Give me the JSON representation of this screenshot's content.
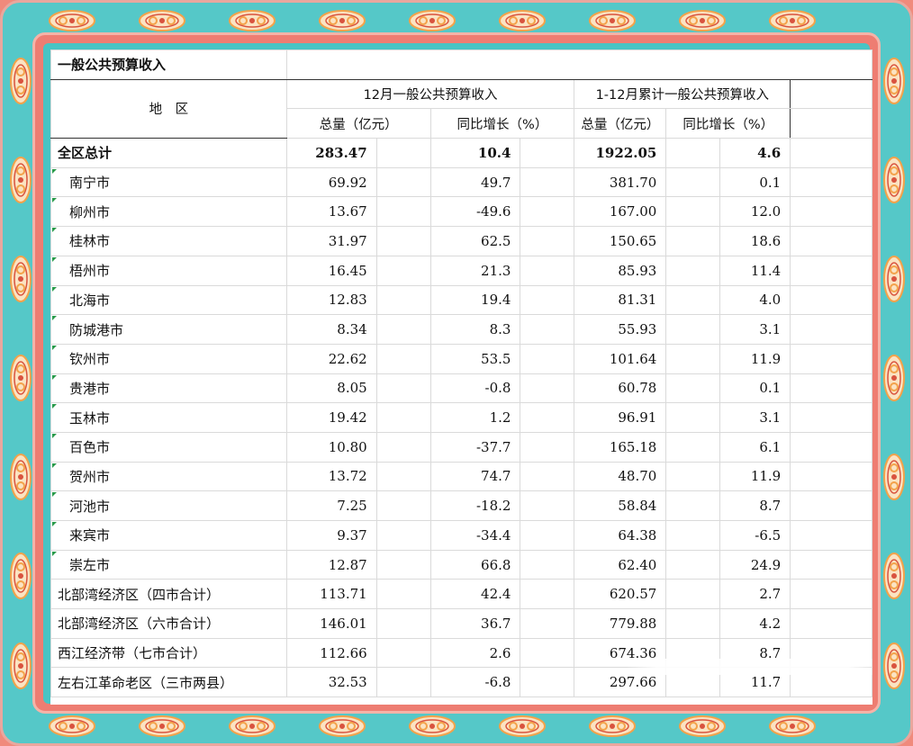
{
  "sheet": {
    "title": "一般公共预算收入",
    "region_header": "地　区",
    "group1_header": "12月一般公共预算收入",
    "group2_header": "1-12月累计一般公共预算收入",
    "sub_total": "总量（亿元）",
    "sub_growth": "同比增长（%）",
    "total_row": {
      "name": "全区总计",
      "m_total": "283.47",
      "m_growth": "10.4",
      "c_total": "1922.05",
      "c_growth": "4.6"
    },
    "rows": [
      {
        "name": "南宁市",
        "m_total": "69.92",
        "m_growth": "49.7",
        "c_total": "381.70",
        "c_growth": "0.1",
        "city": true
      },
      {
        "name": "柳州市",
        "m_total": "13.67",
        "m_growth": "-49.6",
        "c_total": "167.00",
        "c_growth": "12.0",
        "city": true
      },
      {
        "name": "桂林市",
        "m_total": "31.97",
        "m_growth": "62.5",
        "c_total": "150.65",
        "c_growth": "18.6",
        "city": true
      },
      {
        "name": "梧州市",
        "m_total": "16.45",
        "m_growth": "21.3",
        "c_total": "85.93",
        "c_growth": "11.4",
        "city": true
      },
      {
        "name": "北海市",
        "m_total": "12.83",
        "m_growth": "19.4",
        "c_total": "81.31",
        "c_growth": "4.0",
        "city": true
      },
      {
        "name": "防城港市",
        "m_total": "8.34",
        "m_growth": "8.3",
        "c_total": "55.93",
        "c_growth": "3.1",
        "city": true
      },
      {
        "name": "钦州市",
        "m_total": "22.62",
        "m_growth": "53.5",
        "c_total": "101.64",
        "c_growth": "11.9",
        "city": true
      },
      {
        "name": "贵港市",
        "m_total": "8.05",
        "m_growth": "-0.8",
        "c_total": "60.78",
        "c_growth": "0.1",
        "city": true
      },
      {
        "name": "玉林市",
        "m_total": "19.42",
        "m_growth": "1.2",
        "c_total": "96.91",
        "c_growth": "3.1",
        "city": true
      },
      {
        "name": "百色市",
        "m_total": "10.80",
        "m_growth": "-37.7",
        "c_total": "165.18",
        "c_growth": "6.1",
        "city": true
      },
      {
        "name": "贺州市",
        "m_total": "13.72",
        "m_growth": "74.7",
        "c_total": "48.70",
        "c_growth": "11.9",
        "city": true
      },
      {
        "name": "河池市",
        "m_total": "7.25",
        "m_growth": "-18.2",
        "c_total": "58.84",
        "c_growth": "8.7",
        "city": true
      },
      {
        "name": "来宾市",
        "m_total": "9.37",
        "m_growth": "-34.4",
        "c_total": "64.38",
        "c_growth": "-6.5",
        "city": true
      },
      {
        "name": "崇左市",
        "m_total": "12.87",
        "m_growth": "66.8",
        "c_total": "62.40",
        "c_growth": "24.9",
        "city": true
      },
      {
        "name": "北部湾经济区（四市合计）",
        "m_total": "113.71",
        "m_growth": "42.4",
        "c_total": "620.57",
        "c_growth": "2.7",
        "city": false
      },
      {
        "name": "北部湾经济区（六市合计）",
        "m_total": "146.01",
        "m_growth": "36.7",
        "c_total": "779.88",
        "c_growth": "4.2",
        "city": false
      },
      {
        "name": "西江经济带（七市合计）",
        "m_total": "112.66",
        "m_growth": "2.6",
        "c_total": "674.36",
        "c_growth": "8.7",
        "city": false
      },
      {
        "name": "左右江革命老区（三市两县）",
        "m_total": "32.53",
        "m_growth": "-6.8",
        "c_total": "297.66",
        "c_growth": "11.7",
        "city": false
      }
    ]
  },
  "colors": {
    "frame_teal": "#55c8c8",
    "frame_pink": "#ee7d72",
    "ornament": "#f3a24a",
    "city_marker": "#2a9a4a"
  }
}
